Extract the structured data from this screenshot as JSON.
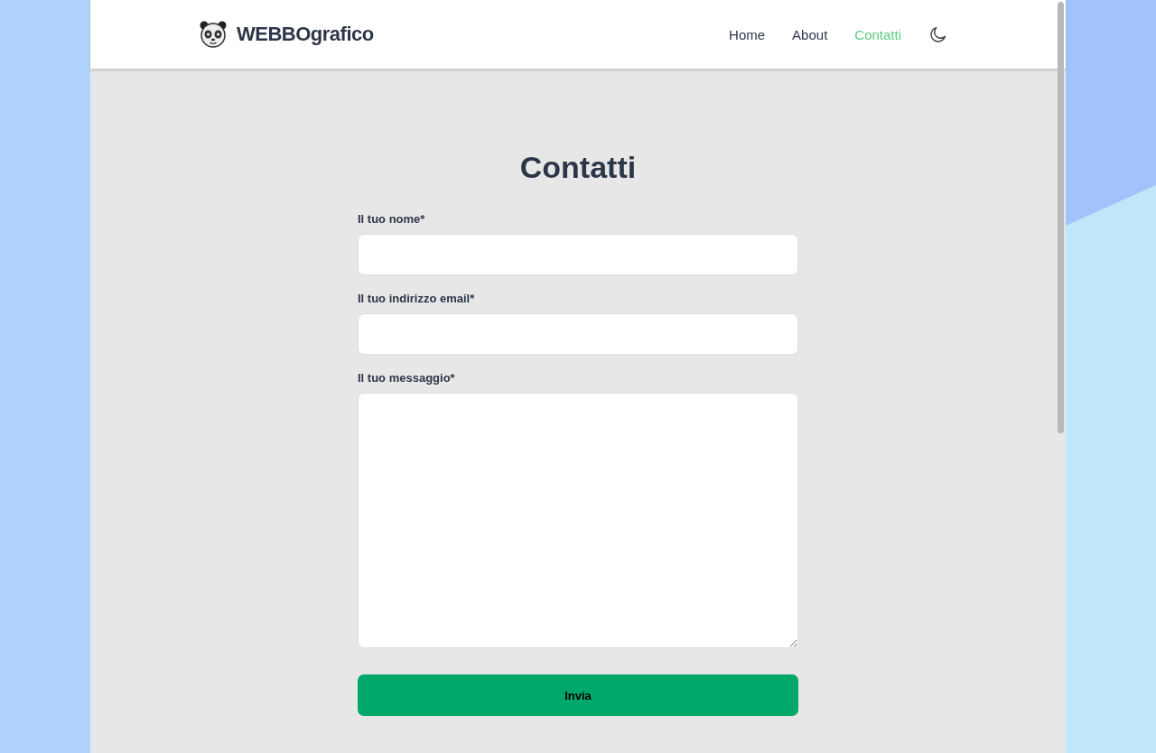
{
  "brand": {
    "name": "WEBBOgrafico"
  },
  "nav": [
    {
      "label": "Home",
      "selected": false
    },
    {
      "label": "About",
      "selected": false
    },
    {
      "label": "Contatti",
      "selected": true
    }
  ],
  "page": {
    "title": "Contatti"
  },
  "form": {
    "fields": [
      {
        "label": "Il tuo nome*",
        "kind": "text"
      },
      {
        "label": "Il tuo indirizzo email*",
        "kind": "email"
      },
      {
        "label": "Il tuo messaggio*",
        "kind": "textarea"
      }
    ],
    "submit": "Invia"
  }
}
